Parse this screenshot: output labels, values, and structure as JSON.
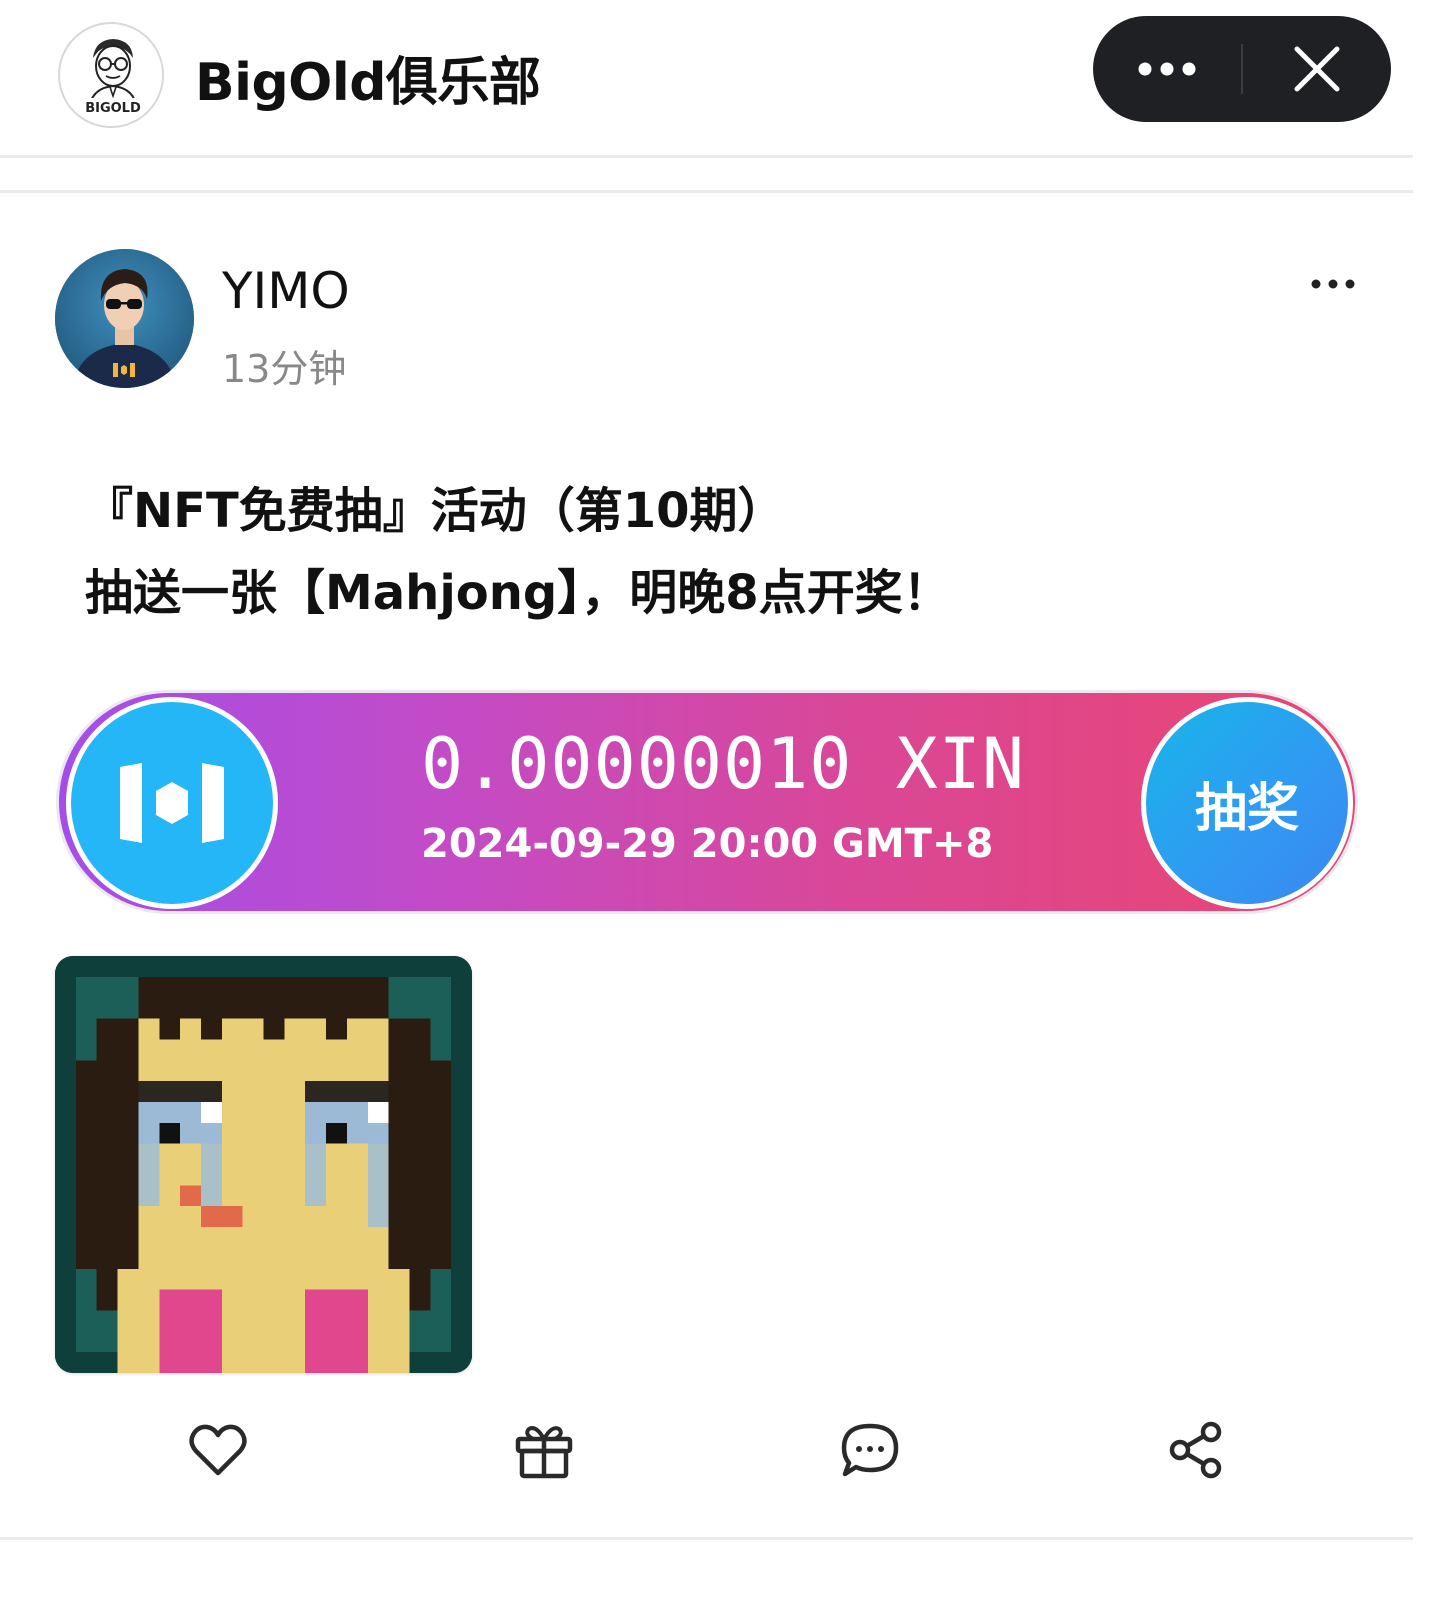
{
  "header": {
    "club_title": "BigOld俱乐部",
    "club_logo_text": "BIGOLD",
    "capsule": {
      "more_icon": "more-dots-icon",
      "close_icon": "close-icon"
    }
  },
  "post": {
    "author_name": "YIMO",
    "time": "13分钟",
    "more_icon": "more-dots-icon",
    "text_line_1": "『NFT免费抽』活动（第10期）",
    "text_line_2": "抽送一张【Mahjong】，明晚8点开奖！",
    "avatar_shirt_logo_icon": "mixin-logo-icon"
  },
  "lottery": {
    "amount": "0.00000010 XIN",
    "draw_time": "2024-09-29 20:00 GMT+8",
    "button_label": "抽奖",
    "logo_icon": "mixin-logo-icon",
    "colors": {
      "gradient_start": "#a44ee8",
      "gradient_end": "#ea4570",
      "logo_bg": "#24b6f6",
      "button_bg": "#2f9bf2"
    }
  },
  "nft": {
    "image_subject": "pixel-art crying woman"
  },
  "actions": [
    {
      "icon": "heart-icon"
    },
    {
      "icon": "gift-icon"
    },
    {
      "icon": "comment-icon"
    },
    {
      "icon": "share-icon"
    }
  ]
}
